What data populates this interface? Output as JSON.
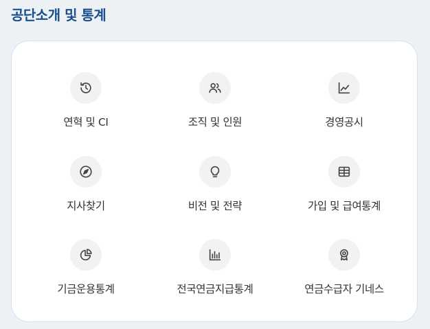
{
  "section": {
    "title": "공단소개 및 통계"
  },
  "menu": {
    "items": [
      {
        "label": "연혁 및 CI",
        "icon": "history-icon"
      },
      {
        "label": "조직 및 인원",
        "icon": "people-icon"
      },
      {
        "label": "경영공시",
        "icon": "line-chart-icon"
      },
      {
        "label": "지사찾기",
        "icon": "compass-icon"
      },
      {
        "label": "비전 및 전략",
        "icon": "lightbulb-icon"
      },
      {
        "label": "가입 및 급여통계",
        "icon": "coin-stack-icon"
      },
      {
        "label": "기금운용통계",
        "icon": "pie-chart-icon"
      },
      {
        "label": "전국연금지급통계",
        "icon": "bar-chart-icon"
      },
      {
        "label": "연금수급자 기네스",
        "icon": "award-icon"
      }
    ]
  },
  "colors": {
    "title": "#1a4f8f",
    "page_background": "#eef1f4",
    "card_border": "#cfe0f1",
    "icon_background": "#f2f2f3",
    "label_text": "#333333"
  }
}
